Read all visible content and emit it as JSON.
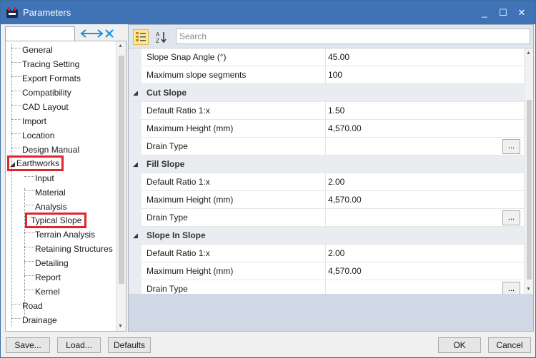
{
  "window": {
    "title": "Parameters",
    "controls": {
      "minimize": "_",
      "maximize": "☐",
      "close": "✕"
    }
  },
  "tree": {
    "items": [
      {
        "label": "General"
      },
      {
        "label": "Tracing Setting"
      },
      {
        "label": "Export Formats"
      },
      {
        "label": "Compatibility"
      },
      {
        "label": "CAD Layout"
      },
      {
        "label": "Import"
      },
      {
        "label": "Location"
      },
      {
        "label": "Design Manual"
      },
      {
        "label": "Earthworks",
        "expanded": true,
        "highlighted": true
      },
      {
        "label": "Input",
        "indent": 1
      },
      {
        "label": "Material",
        "indent": 1
      },
      {
        "label": "Analysis",
        "indent": 1
      },
      {
        "label": "Typical Slope",
        "indent": 1,
        "selected": true,
        "highlighted": true
      },
      {
        "label": "Terrain Analysis",
        "indent": 1
      },
      {
        "label": "Retaining Structures",
        "indent": 1
      },
      {
        "label": "Detailing",
        "indent": 1
      },
      {
        "label": "Report",
        "indent": 1
      },
      {
        "label": "Kernel",
        "indent": 1
      },
      {
        "label": "Road"
      },
      {
        "label": "Drainage"
      }
    ],
    "collapse_icon": "double-arrow-icon",
    "highlight_color": "#e0262d"
  },
  "toolbar": {
    "search_placeholder": "Search",
    "categorized_icon": "categorized-icon",
    "alphabetical_icon": "sort-az-icon"
  },
  "grid": {
    "rows": [
      {
        "type": "prop",
        "name": "Slope Snap Angle (°)",
        "value": "45.00"
      },
      {
        "type": "prop",
        "name": "Maximum slope segments",
        "value": "100"
      },
      {
        "type": "cat",
        "name": "Cut Slope"
      },
      {
        "type": "prop",
        "name": "Default Ratio 1:x",
        "value": "1.50"
      },
      {
        "type": "prop",
        "name": "Maximum Height (mm)",
        "value": "4,570.00"
      },
      {
        "type": "prop",
        "name": "Drain Type",
        "value": "",
        "button": "..."
      },
      {
        "type": "cat",
        "name": "Fill Slope"
      },
      {
        "type": "prop",
        "name": "Default Ratio 1:x",
        "value": "2.00"
      },
      {
        "type": "prop",
        "name": "Maximum Height (mm)",
        "value": "4,570.00"
      },
      {
        "type": "prop",
        "name": "Drain Type",
        "value": "",
        "button": "..."
      },
      {
        "type": "cat",
        "name": "Slope In Slope"
      },
      {
        "type": "prop",
        "name": "Default Ratio 1:x",
        "value": "2.00"
      },
      {
        "type": "prop",
        "name": "Maximum Height (mm)",
        "value": "4,570.00"
      },
      {
        "type": "prop",
        "name": "Drain Type",
        "value": "",
        "button": "..."
      }
    ]
  },
  "footer": {
    "save": "Save...",
    "load": "Load...",
    "defaults": "Defaults",
    "ok": "OK",
    "cancel": "Cancel"
  },
  "colors": {
    "titlebar": "#3f73b5",
    "selection": "#e0262d",
    "toolbar_active": "#fde79a"
  }
}
